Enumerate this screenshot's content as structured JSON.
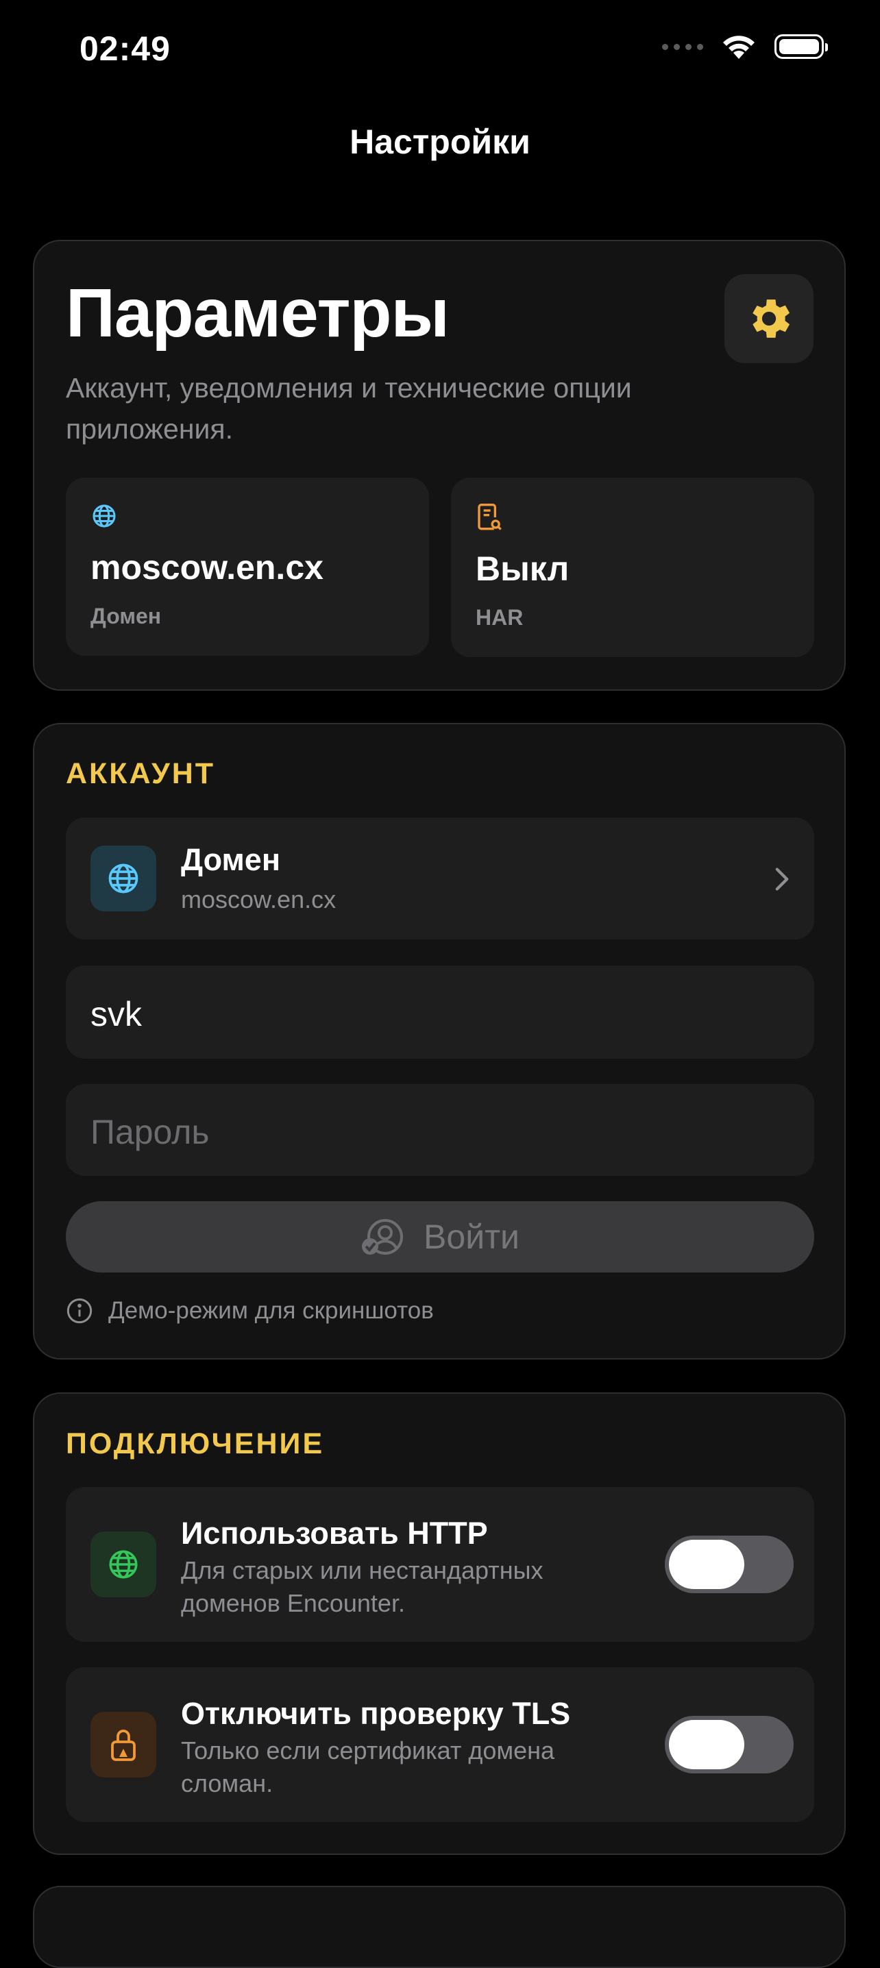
{
  "status_bar": {
    "time": "02:49"
  },
  "nav": {
    "title": "Настройки"
  },
  "hero": {
    "title": "Параметры",
    "subtitle": "Аккаунт, уведомления и технические опции приложения.",
    "stats": [
      {
        "value": "moscow.en.cx",
        "label": "Домен",
        "icon": "globe-icon"
      },
      {
        "value": "Выкл",
        "label": "HAR",
        "icon": "document-search-icon"
      }
    ]
  },
  "account": {
    "section_title": "АККАУНТ",
    "domain_row": {
      "title": "Домен",
      "subtitle": "moscow.en.cx"
    },
    "login_value": "svk",
    "password_placeholder": "Пароль",
    "login_button": "Войти",
    "hint": "Демо-режим для скриншотов"
  },
  "connection": {
    "section_title": "ПОДКЛЮЧЕНИЕ",
    "rows": [
      {
        "title": "Использовать HTTP",
        "subtitle": "Для старых или нестандартных доменов Encounter.",
        "enabled": false
      },
      {
        "title": "Отключить проверку TLS",
        "subtitle": "Только если сертификат домена сломан.",
        "enabled": false
      }
    ]
  },
  "colors": {
    "accent": "#f2c94c",
    "background": "#000000",
    "card": "#131313",
    "tile": "#1e1e1f"
  }
}
